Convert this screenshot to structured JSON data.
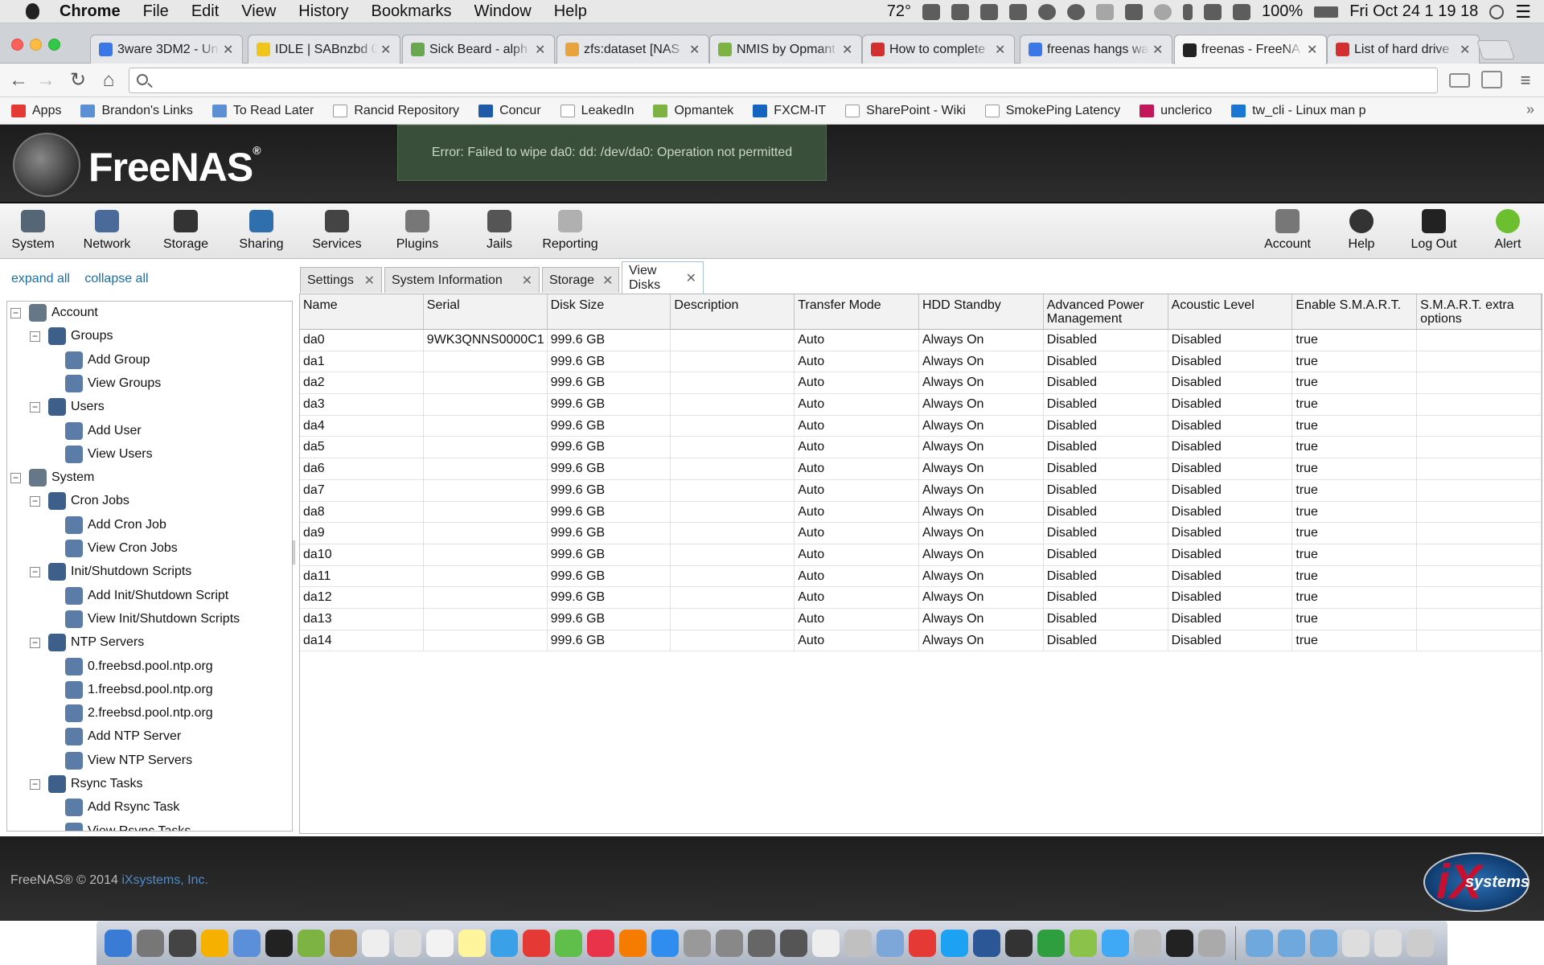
{
  "menubar": {
    "app": "Chrome",
    "items": [
      "File",
      "Edit",
      "View",
      "History",
      "Bookmarks",
      "Window",
      "Help"
    ],
    "temperature": "72°",
    "battery": "100%",
    "datetime": "Fri Oct 24  1 19 18"
  },
  "tabs": [
    {
      "label": "3ware 3DM2 - Un",
      "fav": "#3b78e7"
    },
    {
      "label": "IDLE | SABnzbd 0",
      "fav": "#f0c419"
    },
    {
      "label": "Sick Beard - alph",
      "fav": "#6aa84f"
    },
    {
      "label": "zfs:dataset [NAS",
      "fav": "#e8a33b"
    },
    {
      "label": "NMIS by Opmant",
      "fav": "#7cb342"
    },
    {
      "label": "How to complete",
      "fav": "#d32f2f"
    },
    {
      "label": "freenas hangs wa",
      "fav": "#3b78e7"
    },
    {
      "label": "freenas - FreeNA",
      "fav": "#222222",
      "active": true
    },
    {
      "label": "List of hard drive",
      "fav": "#d32f2f"
    }
  ],
  "bookmarks": [
    {
      "label": "Apps",
      "type": "apps"
    },
    {
      "label": "Brandon's Links",
      "type": "folder"
    },
    {
      "label": "To Read Later",
      "type": "folder"
    },
    {
      "label": "Rancid Repository",
      "type": "page"
    },
    {
      "label": "Concur",
      "type": "concur"
    },
    {
      "label": "LeakedIn",
      "type": "page"
    },
    {
      "label": "Opmantek",
      "type": "opm"
    },
    {
      "label": "FXCM-IT",
      "type": "fx"
    },
    {
      "label": "SharePoint - Wiki",
      "type": "page"
    },
    {
      "label": "SmokePing Latency",
      "type": "page"
    },
    {
      "label": "unclerico",
      "type": "feather"
    },
    {
      "label": "tw_cli - Linux man p",
      "type": "tw"
    }
  ],
  "freenas": {
    "logo": "FreeNAS",
    "error": "Error: Failed to wipe da0: dd: /dev/da0: Operation not permitted",
    "nav_left": [
      "System",
      "Network",
      "Storage",
      "Sharing",
      "Services",
      "Plugins",
      "Jails",
      "Reporting"
    ],
    "nav_right": [
      "Account",
      "Help",
      "Log Out",
      "Alert"
    ]
  },
  "sidebar": {
    "expand_all": "expand all",
    "collapse_all": "collapse all",
    "tree": [
      {
        "label": "Account",
        "level": 0,
        "exp": "−"
      },
      {
        "label": "Groups",
        "level": 1,
        "exp": "−"
      },
      {
        "label": "Add Group",
        "level": 2
      },
      {
        "label": "View Groups",
        "level": 2
      },
      {
        "label": "Users",
        "level": 1,
        "exp": "−"
      },
      {
        "label": "Add User",
        "level": 2
      },
      {
        "label": "View Users",
        "level": 2
      },
      {
        "label": "System",
        "level": 0,
        "exp": "−"
      },
      {
        "label": "Cron Jobs",
        "level": 1,
        "exp": "−"
      },
      {
        "label": "Add Cron Job",
        "level": 2
      },
      {
        "label": "View Cron Jobs",
        "level": 2
      },
      {
        "label": "Init/Shutdown Scripts",
        "level": 1,
        "exp": "−"
      },
      {
        "label": "Add Init/Shutdown Script",
        "level": 2
      },
      {
        "label": "View Init/Shutdown Scripts",
        "level": 2
      },
      {
        "label": "NTP Servers",
        "level": 1,
        "exp": "−"
      },
      {
        "label": "0.freebsd.pool.ntp.org",
        "level": 2
      },
      {
        "label": "1.freebsd.pool.ntp.org",
        "level": 2
      },
      {
        "label": "2.freebsd.pool.ntp.org",
        "level": 2
      },
      {
        "label": "Add NTP Server",
        "level": 2
      },
      {
        "label": "View NTP Servers",
        "level": 2
      },
      {
        "label": "Rsync Tasks",
        "level": 1,
        "exp": "−"
      },
      {
        "label": "Add Rsync Task",
        "level": 2
      },
      {
        "label": "View Rsync Tasks",
        "level": 2
      }
    ]
  },
  "content_tabs": [
    {
      "label": "Settings"
    },
    {
      "label": "System Information"
    },
    {
      "label": "Storage"
    },
    {
      "label": "View Disks",
      "active": true
    }
  ],
  "table": {
    "columns": [
      "Name",
      "Serial",
      "Disk Size",
      "Description",
      "Transfer Mode",
      "HDD Standby",
      "Advanced Power Management",
      "Acoustic Level",
      "Enable S.M.A.R.T.",
      "S.M.A.R.T. extra options"
    ],
    "rows": [
      [
        "da0",
        "9WK3QNNS0000C1",
        "999.6 GB",
        "",
        "Auto",
        "Always On",
        "Disabled",
        "Disabled",
        "true",
        ""
      ],
      [
        "da1",
        "",
        "999.6 GB",
        "",
        "Auto",
        "Always On",
        "Disabled",
        "Disabled",
        "true",
        ""
      ],
      [
        "da2",
        "",
        "999.6 GB",
        "",
        "Auto",
        "Always On",
        "Disabled",
        "Disabled",
        "true",
        ""
      ],
      [
        "da3",
        "",
        "999.6 GB",
        "",
        "Auto",
        "Always On",
        "Disabled",
        "Disabled",
        "true",
        ""
      ],
      [
        "da4",
        "",
        "999.6 GB",
        "",
        "Auto",
        "Always On",
        "Disabled",
        "Disabled",
        "true",
        ""
      ],
      [
        "da5",
        "",
        "999.6 GB",
        "",
        "Auto",
        "Always On",
        "Disabled",
        "Disabled",
        "true",
        ""
      ],
      [
        "da6",
        "",
        "999.6 GB",
        "",
        "Auto",
        "Always On",
        "Disabled",
        "Disabled",
        "true",
        ""
      ],
      [
        "da7",
        "",
        "999.6 GB",
        "",
        "Auto",
        "Always On",
        "Disabled",
        "Disabled",
        "true",
        ""
      ],
      [
        "da8",
        "",
        "999.6 GB",
        "",
        "Auto",
        "Always On",
        "Disabled",
        "Disabled",
        "true",
        ""
      ],
      [
        "da9",
        "",
        "999.6 GB",
        "",
        "Auto",
        "Always On",
        "Disabled",
        "Disabled",
        "true",
        ""
      ],
      [
        "da10",
        "",
        "999.6 GB",
        "",
        "Auto",
        "Always On",
        "Disabled",
        "Disabled",
        "true",
        ""
      ],
      [
        "da11",
        "",
        "999.6 GB",
        "",
        "Auto",
        "Always On",
        "Disabled",
        "Disabled",
        "true",
        ""
      ],
      [
        "da12",
        "",
        "999.6 GB",
        "",
        "Auto",
        "Always On",
        "Disabled",
        "Disabled",
        "true",
        ""
      ],
      [
        "da13",
        "",
        "999.6 GB",
        "",
        "Auto",
        "Always On",
        "Disabled",
        "Disabled",
        "true",
        ""
      ],
      [
        "da14",
        "",
        "999.6 GB",
        "",
        "Auto",
        "Always On",
        "Disabled",
        "Disabled",
        "true",
        ""
      ]
    ]
  },
  "footer": {
    "text": "FreeNAS® © 2014 ",
    "link": "iXsystems, Inc.",
    "logo": "systems"
  },
  "colors": {
    "error_bg": "#3a4f3a",
    "link": "#1a6ea8",
    "header_bg": "#222222"
  }
}
